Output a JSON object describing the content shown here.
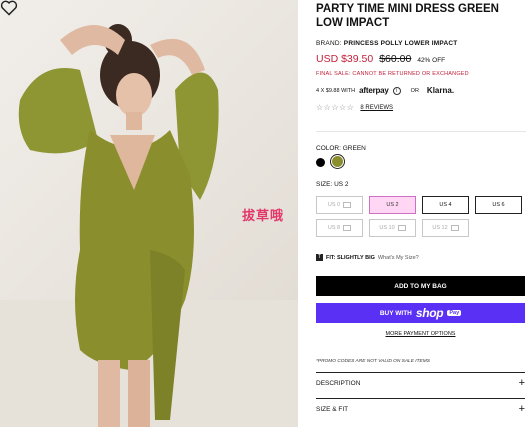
{
  "product": {
    "title": "PARTY TIME MINI DRESS GREEN LOW IMPACT",
    "brand_label": "BRAND:",
    "brand_value": "PRINCESS POLLY LOWER IMPACT",
    "price_now": "USD $39.50",
    "price_old": "$60.00",
    "discount": "42% OFF",
    "final_sale": "FINAL SALE: CANNOT BE RETURNED OR EXCHANGED"
  },
  "payments": {
    "installments": "4 X $9.88 WITH",
    "afterpay": "afterpay",
    "or": "OR",
    "klarna": "Klarna."
  },
  "reviews": {
    "stars": "☆☆☆☆☆",
    "link": "8 REVIEWS"
  },
  "color": {
    "label": "COLOR:",
    "value": "GREEN",
    "options": [
      "black",
      "green"
    ]
  },
  "size": {
    "label": "SIZE:",
    "value": "US 2",
    "options": [
      "US 0",
      "US 2",
      "US 4",
      "US 6",
      "US 8",
      "US 10",
      "US 12"
    ]
  },
  "fit": {
    "icon": "T",
    "label": "FIT: SLIGHTLY BIG",
    "link": "What's My Size?"
  },
  "actions": {
    "add_to_bag": "ADD TO MY BAG",
    "buy_with": "BUY WITH",
    "shop": "shop",
    "pay": "Pay",
    "more_payment": "MORE PAYMENT OPTIONS"
  },
  "promo_note": "*PROMO CODES ARE NOT VALID ON SALE ITEMS",
  "accordions": [
    "DESCRIPTION",
    "SIZE & FIT"
  ],
  "watermark": "拔草哦",
  "colors": {
    "sale_red": "#c3203b",
    "shop_pay": "#5a31f4",
    "dress_green": "#8b8e2c",
    "selected_size": "#ffd6f3"
  }
}
